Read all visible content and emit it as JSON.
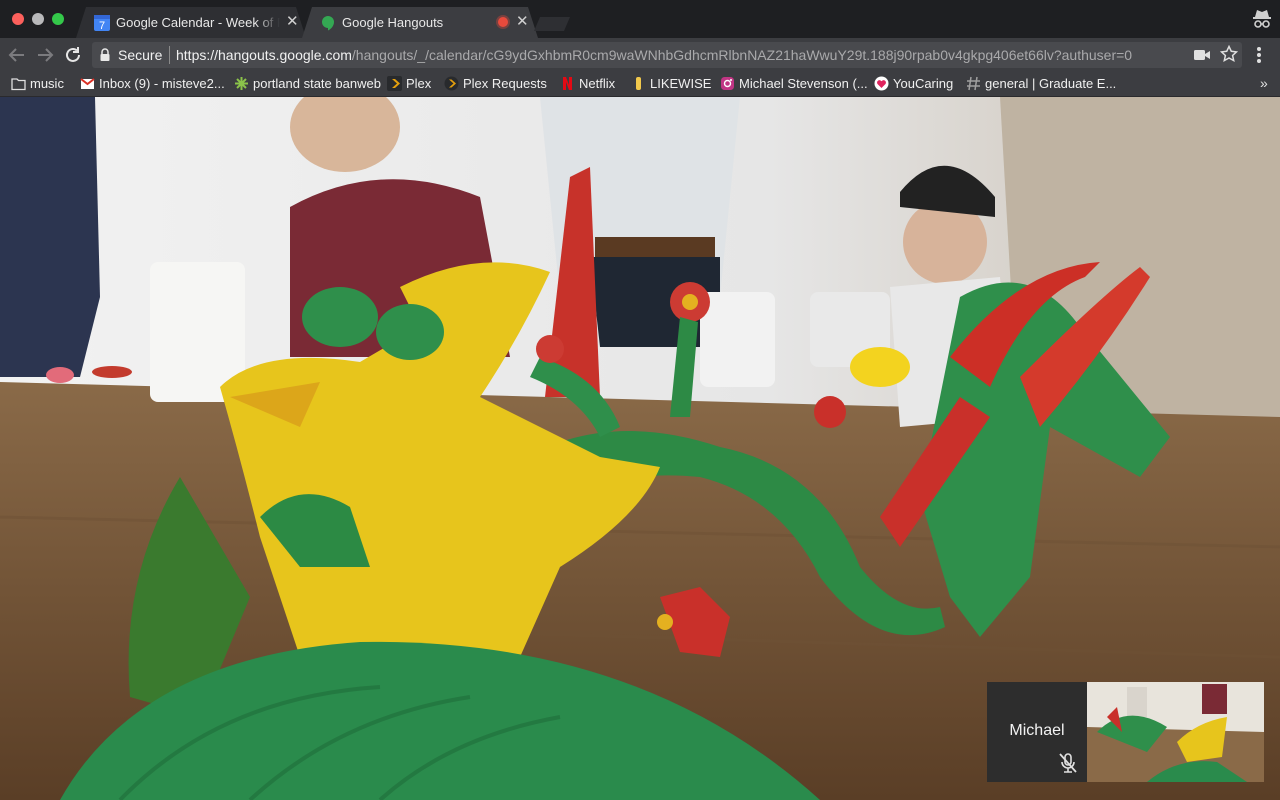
{
  "tabs": [
    {
      "title": "Google Calendar - Week of Feb",
      "favicon": "calendar-icon",
      "favicon_text": "7"
    },
    {
      "title": "Google Hangouts",
      "favicon": "hangouts-icon",
      "recording": true
    }
  ],
  "omnibox": {
    "security_label": "Secure",
    "url_host": "https://hangouts.google.com",
    "url_path": "/hangouts/_/calendar/cG9ydGxhbmR0cm9waWNhbGdhcmRlbnNAZ21haWwuY29t.188j90rpab0v4gkpg406et66lv?authuser=0"
  },
  "bookmarks": [
    {
      "label": "music",
      "icon": "folder-icon"
    },
    {
      "label": "Inbox (9) - misteve2...",
      "icon": "gmail-icon"
    },
    {
      "label": "portland state banweb",
      "icon": "psu-icon"
    },
    {
      "label": "Plex",
      "icon": "plex-icon"
    },
    {
      "label": "Plex Requests",
      "icon": "plex-requests-icon"
    },
    {
      "label": "Netflix",
      "icon": "netflix-icon"
    },
    {
      "label": "LIKEWISE",
      "icon": "likewise-icon"
    },
    {
      "label": "Michael Stevenson (...",
      "icon": "instagram-icon"
    },
    {
      "label": "YouCaring",
      "icon": "youcaring-icon"
    },
    {
      "label": "general | Graduate E...",
      "icon": "slack-icon"
    }
  ],
  "bookmarks_overflow": "»",
  "call": {
    "self_view_name": "Michael",
    "mic_muted": true
  },
  "colors": {
    "tab_active": "#3c3d41",
    "toolbar": "#3c3d41",
    "record_dot": "#e84a3c"
  }
}
